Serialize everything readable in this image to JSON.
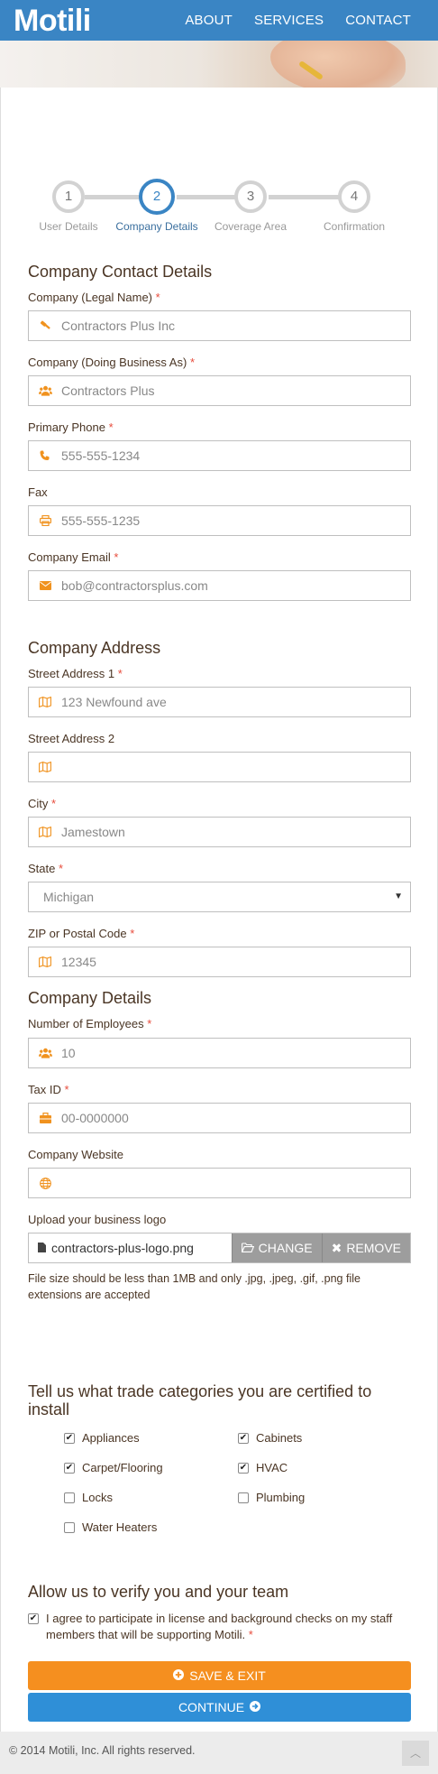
{
  "header": {
    "logo": "Motili",
    "nav": [
      "ABOUT",
      "SERVICES",
      "CONTACT"
    ]
  },
  "stepper": {
    "steps": [
      {
        "number": "1",
        "label": "User Details"
      },
      {
        "number": "2",
        "label": "Company Details"
      },
      {
        "number": "3",
        "label": "Coverage Area"
      },
      {
        "number": "4",
        "label": "Confirmation"
      }
    ],
    "active_step": 2
  },
  "contact": {
    "title": "Company Contact Details",
    "legal_name": {
      "label": "Company (Legal Name)",
      "required": "*",
      "value": "Contractors Plus Inc",
      "icon": "gavel-icon"
    },
    "dba": {
      "label": "Company (Doing Business As)",
      "required": "*",
      "value": "Contractors Plus",
      "icon": "users-icon"
    },
    "phone": {
      "label": "Primary Phone",
      "required": "*",
      "value": "555-555-1234",
      "icon": "phone-icon"
    },
    "fax": {
      "label": "Fax",
      "value": "555-555-1235",
      "icon": "print-icon"
    },
    "email": {
      "label": "Company Email",
      "required": "*",
      "value": "bob@contractorsplus.com",
      "icon": "envelope-icon"
    }
  },
  "address": {
    "title": "Company Address",
    "street1": {
      "label": "Street Address 1",
      "required": "*",
      "value": "123 Newfound ave",
      "icon": "map-icon"
    },
    "street2": {
      "label": "Street Address 2",
      "value": "",
      "icon": "map-icon"
    },
    "city": {
      "label": "City",
      "required": "*",
      "value": "Jamestown",
      "icon": "map-icon"
    },
    "state": {
      "label": "State",
      "required": "*",
      "value": "Michigan"
    },
    "zip": {
      "label": "ZIP or Postal Code",
      "required": "*",
      "value": "12345",
      "icon": "map-icon"
    }
  },
  "details": {
    "title": "Company Details",
    "employees": {
      "label": "Number of Employees",
      "required": "*",
      "value": "10",
      "icon": "users-icon"
    },
    "tax_id": {
      "label": "Tax ID",
      "required": "*",
      "value": "00-0000000",
      "icon": "briefcase-icon"
    },
    "website": {
      "label": "Company Website",
      "value": "",
      "icon": "globe-icon"
    },
    "upload": {
      "label": "Upload your business logo",
      "filename": "contractors-plus-logo.png",
      "change": "CHANGE",
      "remove": "REMOVE",
      "note": "File size should be less than 1MB and only .jpg, .jpeg, .gif, .png file extensions are accepted"
    }
  },
  "trades": {
    "title": "Tell us what trade categories you are certified to install",
    "items": [
      {
        "label": "Appliances",
        "checked": true
      },
      {
        "label": "Cabinets",
        "checked": true
      },
      {
        "label": "Carpet/Flooring",
        "checked": true
      },
      {
        "label": "HVAC",
        "checked": true
      },
      {
        "label": "Locks",
        "checked": false
      },
      {
        "label": "Plumbing",
        "checked": false
      },
      {
        "label": "Water Heaters",
        "checked": false
      }
    ]
  },
  "verify": {
    "title": "Allow us to verify you and your team",
    "consent": "I agree to participate in license and background checks on my staff members that will be supporting Motili.",
    "required": "*",
    "checked": true
  },
  "actions": {
    "save_exit": "SAVE & EXIT",
    "continue": "CONTINUE"
  },
  "footer": {
    "copyright": "© 2014 Motili, Inc. All rights reserved."
  },
  "colors": {
    "brand_blue": "#3a85c4",
    "accent_orange": "#f58f1f",
    "continue_blue": "#2f8fd7"
  }
}
